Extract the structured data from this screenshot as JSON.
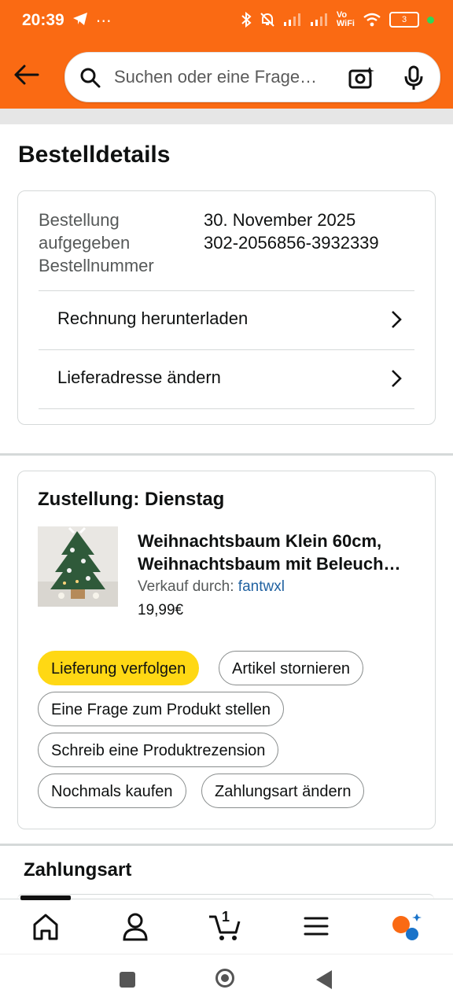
{
  "status_bar": {
    "time": "20:39",
    "battery": "3",
    "left_icons": [
      "telegram-icon",
      "more-icon"
    ],
    "right_icons": [
      "bluetooth-icon",
      "silent-icon",
      "signal-icon",
      "signal-icon",
      "volte-wifi-icon",
      "wifi-icon",
      "battery-icon"
    ]
  },
  "header": {
    "search_placeholder": "Suchen oder eine Frage…",
    "colors": {
      "bar": "#fa6a13"
    }
  },
  "page": {
    "title": "Bestelldetails"
  },
  "order_info": {
    "label_lines": [
      "Bestellung",
      "aufgegeben",
      "Bestellnummer"
    ],
    "order_date": "30. November 2025",
    "order_number": "302-2056856-3932339",
    "actions": [
      {
        "label": "Rechnung herunterladen"
      },
      {
        "label": "Lieferadresse ändern"
      }
    ]
  },
  "shipment": {
    "title": "Zustellung: Dienstag",
    "product": {
      "name_line1": "Weihnachtsbaum Klein 60cm,",
      "name_line2": "Weihnachtsbaum mit Beleuch…",
      "seller_prefix": "Verkauf durch: ",
      "seller": "fantwxl",
      "price": "19,99€"
    },
    "buttons": [
      {
        "label": "Lieferung verfolgen",
        "primary": true
      },
      {
        "label": "Artikel stornieren"
      },
      {
        "label": "Eine Frage zum Produkt stellen"
      },
      {
        "label": "Schreib eine Produktrezension"
      },
      {
        "label": "Nochmals kaufen"
      },
      {
        "label": "Zahlungsart ändern"
      }
    ],
    "accent": "#ffd814"
  },
  "payment": {
    "title": "Zahlungsart"
  },
  "bottom_nav": {
    "items": [
      "home-icon",
      "account-icon",
      "cart-icon",
      "menu-icon",
      "rufus-icon"
    ],
    "cart_count": "1",
    "selected": "home"
  }
}
